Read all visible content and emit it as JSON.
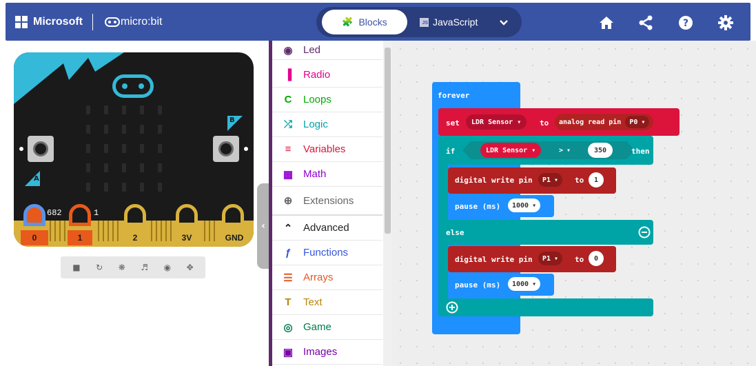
{
  "header": {
    "brand": "Microsoft",
    "product": "micro:bit",
    "tabs": {
      "blocks": "Blocks",
      "javascript": "JavaScript"
    },
    "colors": {
      "bar": "#3954a5",
      "toggle": "#2a3d7c"
    },
    "icons": [
      "home-icon",
      "share-icon",
      "help-icon",
      "settings-icon"
    ]
  },
  "simulator": {
    "button_a": "A",
    "button_b": "B",
    "pins": [
      "0",
      "1",
      "2",
      "3V",
      "GND"
    ],
    "pin_values": {
      "p0": "682",
      "p1": "1"
    },
    "tools": [
      "stop-icon",
      "restart-icon",
      "debug-icon",
      "mute-icon",
      "screenshot-icon",
      "fullscreen-icon"
    ]
  },
  "toolbox": {
    "categories": [
      {
        "label": "Led",
        "color": "#5e2a6b",
        "icon": "toggle-icon"
      },
      {
        "label": "Radio",
        "color": "#e3008c",
        "icon": "signal-bars-icon"
      },
      {
        "label": "Loops",
        "color": "#00aa00",
        "icon": "loop-arrow-icon"
      },
      {
        "label": "Logic",
        "color": "#00a4a6",
        "icon": "shuffle-icon"
      },
      {
        "label": "Variables",
        "color": "#dc143c",
        "icon": "list-lines-icon"
      },
      {
        "label": "Math",
        "color": "#9400d3",
        "icon": "calculator-icon"
      },
      {
        "label": "Extensions",
        "color": "#666666",
        "icon": "plus-circle-icon"
      },
      {
        "label": "Advanced",
        "color": "#222222",
        "icon": "chevron-up-icon"
      },
      {
        "label": "Functions",
        "color": "#3455db",
        "icon": "function-icon"
      },
      {
        "label": "Arrays",
        "color": "#e65722",
        "icon": "array-list-icon"
      },
      {
        "label": "Text",
        "color": "#b8860b",
        "icon": "text-icon"
      },
      {
        "label": "Game",
        "color": "#007a4b",
        "icon": "gamepad-icon"
      },
      {
        "label": "Images",
        "color": "#7600a8",
        "icon": "image-icon"
      }
    ]
  },
  "workspace": {
    "forever": "forever",
    "set_kw": "set",
    "variable": "LDR Sensor",
    "to_kw": "to",
    "read_fn": "analog read pin",
    "read_pin": "P0",
    "if_kw": "if",
    "compare_var": "LDR Sensor",
    "operator": ">",
    "threshold": "350",
    "then_kw": "then",
    "write_fn": "digital write pin",
    "write_pin": "P1",
    "write_to": "to",
    "write_value_on": "1",
    "pause_kw": "pause (ms)",
    "pause_value": "1000",
    "else_kw": "else",
    "write_value_off": "0",
    "colors": {
      "loops": "#1e90ff",
      "variables": "#dc143c",
      "logic": "#00a4a6",
      "pins": "#b22222"
    }
  }
}
